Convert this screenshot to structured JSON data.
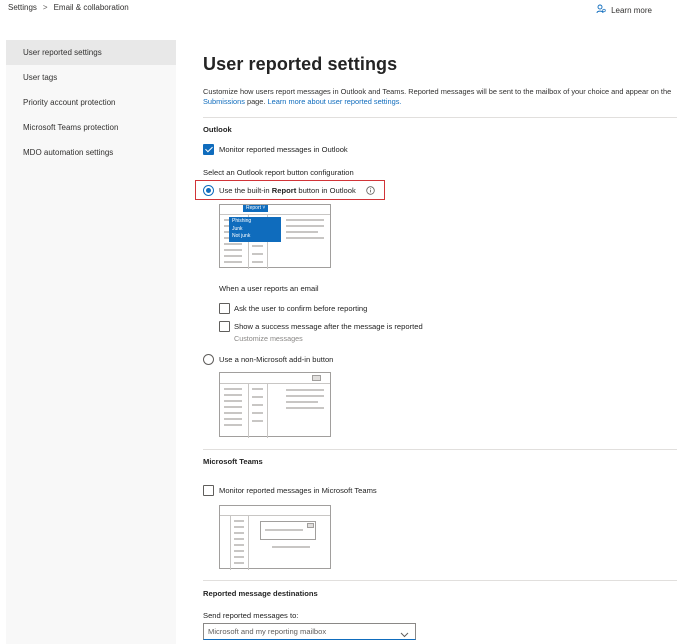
{
  "breadcrumb": {
    "root": "Settings",
    "separator": ">",
    "current": "Email & collaboration"
  },
  "header": {
    "learn_more": "Learn more"
  },
  "nav": {
    "items": [
      {
        "label": "User reported settings",
        "active": true
      },
      {
        "label": "User tags"
      },
      {
        "label": "Priority account protection"
      },
      {
        "label": "Microsoft Teams protection"
      },
      {
        "label": "MDO automation settings"
      }
    ]
  },
  "page": {
    "title": "User reported settings",
    "desc_part1": "Customize how users report messages in Outlook and Teams. Reported messages will be sent to the mailbox of your choice and appear on the ",
    "desc_link1": "Submissions",
    "desc_part2": " page. ",
    "desc_link2": "Learn more about user reported settings."
  },
  "outlook": {
    "heading": "Outlook",
    "monitor_label": "Monitor reported messages in Outlook",
    "monitor_checked": true,
    "config_heading": "Select an Outlook report button configuration",
    "builtin_prefix": "Use the built-in ",
    "builtin_bold": "Report",
    "builtin_suffix": " button in Outlook",
    "builtin_selected": true,
    "report_button": "Report",
    "report_menu": [
      "Phishing",
      "Junk",
      "Not junk"
    ],
    "when_heading": "When a user reports an email",
    "ask_confirm_label": "Ask the user to confirm before reporting",
    "ask_confirm_checked": false,
    "show_success_label": "Show a success message after the message is reported",
    "show_success_checked": false,
    "customize_messages": "Customize messages",
    "nonms_label": "Use a non-Microsoft add-in button",
    "nonms_selected": false
  },
  "teams": {
    "heading": "Microsoft Teams",
    "monitor_label": "Monitor reported messages in Microsoft Teams",
    "monitor_checked": false
  },
  "destinations": {
    "heading": "Reported message destinations",
    "send_label": "Send reported messages to:",
    "send_value": "Microsoft and my reporting mailbox"
  },
  "colors": {
    "accent": "#0f6cbd",
    "highlight": "#d13438",
    "nav_bg": "#f8f8f8",
    "nav_active": "#e8e8e8"
  }
}
